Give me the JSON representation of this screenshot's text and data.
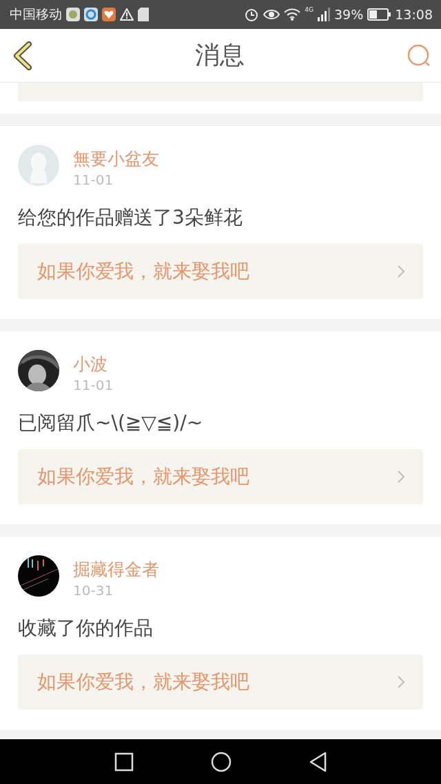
{
  "status_bar": {
    "carrier": "中国移动",
    "network": "4G",
    "battery": "39%",
    "time": "13:08"
  },
  "header": {
    "title": "消息"
  },
  "messages": [
    {
      "avatar": {
        "kind": "silhouette"
      },
      "name": "無要小盆友",
      "date": "11-01",
      "text": "给您的作品赠送了3朵鲜花",
      "quote": "如果你爱我，就来娶我吧"
    },
    {
      "name": "小波",
      "date": "11-01",
      "text": "已阅留爪~\\(≧▽≦)/~",
      "quote": "如果你爱我，就来娶我吧"
    },
    {
      "avatar": {
        "kind": "chart-picture"
      },
      "name": "掘藏得金者",
      "date": "10-31",
      "text": "收藏了你的作品",
      "quote": "如果你爱我，就来娶我吧"
    }
  ]
}
